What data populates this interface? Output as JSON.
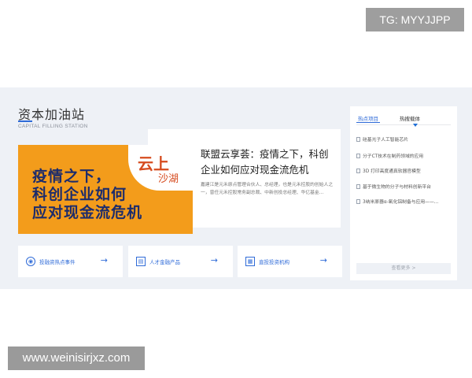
{
  "watermarks": {
    "top": "TG: MYYJJPP",
    "bottom": "www.weinisirjxz.com"
  },
  "section": {
    "title": "资本加油站",
    "subtitle": "CAPITAL FILLING STATION"
  },
  "feature": {
    "banner_lines": [
      "疫情之下，",
      "科创企业如何",
      "应对现金流危机"
    ],
    "badge_main": "云上",
    "badge_sub": "沙湖",
    "title": "联盟云享荟：疫情之下，科创企业如何应对现金流危机",
    "desc": "嘉建江是元禾原点管理合伙人、总经理，也是元禾控股的创始人之一，曾任元禾控股常务副总裁、中新创投总经理、华亿基金...",
    "prev_icon": "chevron-left-icon",
    "next_icon": "chevron-right-icon"
  },
  "categories": [
    {
      "label": "投融资热点事件",
      "icon": "target-icon"
    },
    {
      "label": "人才金融产品",
      "icon": "card-icon"
    },
    {
      "label": "直投投资机构",
      "icon": "building-icon"
    }
  ],
  "hot_panel": {
    "tabs": [
      "热点项目",
      "热搜载体"
    ],
    "items": [
      "硅基光子人工智能芯片",
      "分子CT技术在制药领域的应用",
      "3D 打印高度通真软器官模型",
      "基于微生物的分子与材料创新平台",
      "3纳米原器α-氧化铝制备与应用——..."
    ],
    "more": "查看更多 >"
  },
  "colors": {
    "accent": "#2f6bd8",
    "banner": "#f39c1b",
    "band": "#eef1f6"
  }
}
